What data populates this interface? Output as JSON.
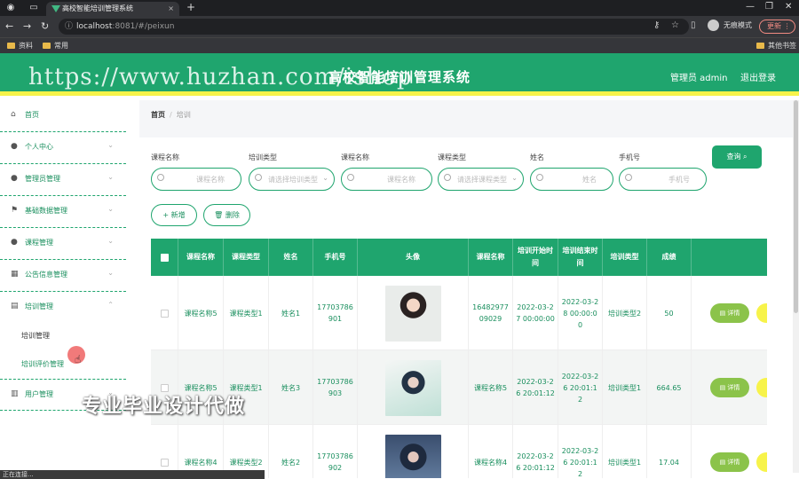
{
  "browser": {
    "tab_title": "高校智能培训管理系统",
    "url_host": "localhost",
    "url_rest": ":8081/#/peixun",
    "profile_label": "无痕模式",
    "update_label": "更新",
    "bookmarks": [
      "资料",
      "常用"
    ],
    "other_bookmarks": "其他书签",
    "status_text": "正在连接..."
  },
  "header": {
    "title": "高校智能培训管理系统",
    "admin_label": "管理员 admin",
    "logout_label": "退出登录",
    "watermark_url": "https://www.huzhan.com/ishop"
  },
  "sidebar": {
    "items": [
      {
        "label": "首页",
        "icon": "home-icon"
      },
      {
        "label": "个人中心",
        "icon": "user-icon"
      },
      {
        "label": "管理员管理",
        "icon": "bulb-icon"
      },
      {
        "label": "基础数据管理",
        "icon": "flag-icon"
      },
      {
        "label": "课程管理",
        "icon": "user-icon"
      },
      {
        "label": "公告信息管理",
        "icon": "grid-icon"
      },
      {
        "label": "培训管理",
        "icon": "chart-icon"
      },
      {
        "label": "用户管理",
        "icon": "table-icon"
      }
    ],
    "sub_items": [
      "培训管理",
      "培训评价管理"
    ]
  },
  "breadcrumb": {
    "home": "首页",
    "sep": "/",
    "current": "培训"
  },
  "filters": [
    {
      "label": "课程名称",
      "placeholder": "课程名称",
      "select": false
    },
    {
      "label": "培训类型",
      "placeholder": "请选择培训类型",
      "select": true
    },
    {
      "label": "课程名称",
      "placeholder": "课程名称",
      "select": false
    },
    {
      "label": "课程类型",
      "placeholder": "请选择课程类型",
      "select": true
    },
    {
      "label": "姓名",
      "placeholder": "姓名",
      "select": false
    },
    {
      "label": "手机号",
      "placeholder": "手机号",
      "select": false
    }
  ],
  "query_label": "查询",
  "add_label": "+ 新增",
  "delete_label": "删除",
  "table": {
    "headers": [
      "课程名称",
      "课程类型",
      "姓名",
      "手机号",
      "头像",
      "课程名称",
      "培训开始时间",
      "培训结束时间",
      "培训类型",
      "成绩"
    ],
    "rows": [
      {
        "c1": "课程名称5",
        "c2": "课程类型1",
        "c3": "姓名1",
        "c4": "17703786901",
        "c6": "1648297709029",
        "c7": "2022-03-27 00:00:00",
        "c8": "2022-03-28 00:00:00",
        "c9": "培训类型2",
        "c10": "50",
        "detail": "详情"
      },
      {
        "c1": "课程名称5",
        "c2": "课程类型1",
        "c3": "姓名3",
        "c4": "17703786903",
        "c6": "课程名称5",
        "c7": "2022-03-26 20:01:12",
        "c8": "2022-03-26 20:01:12",
        "c9": "培训类型1",
        "c10": "664.65",
        "detail": "详情"
      },
      {
        "c1": "课程名称4",
        "c2": "课程类型2",
        "c3": "姓名2",
        "c4": "17703786902",
        "c6": "课程名称4",
        "c7": "2022-03-26 20:01:12",
        "c8": "2022-03-26 20:01:12",
        "c9": "培训类型1",
        "c10": "17.04",
        "detail": "详情"
      }
    ]
  },
  "promo_text": "专业毕业设计代做"
}
